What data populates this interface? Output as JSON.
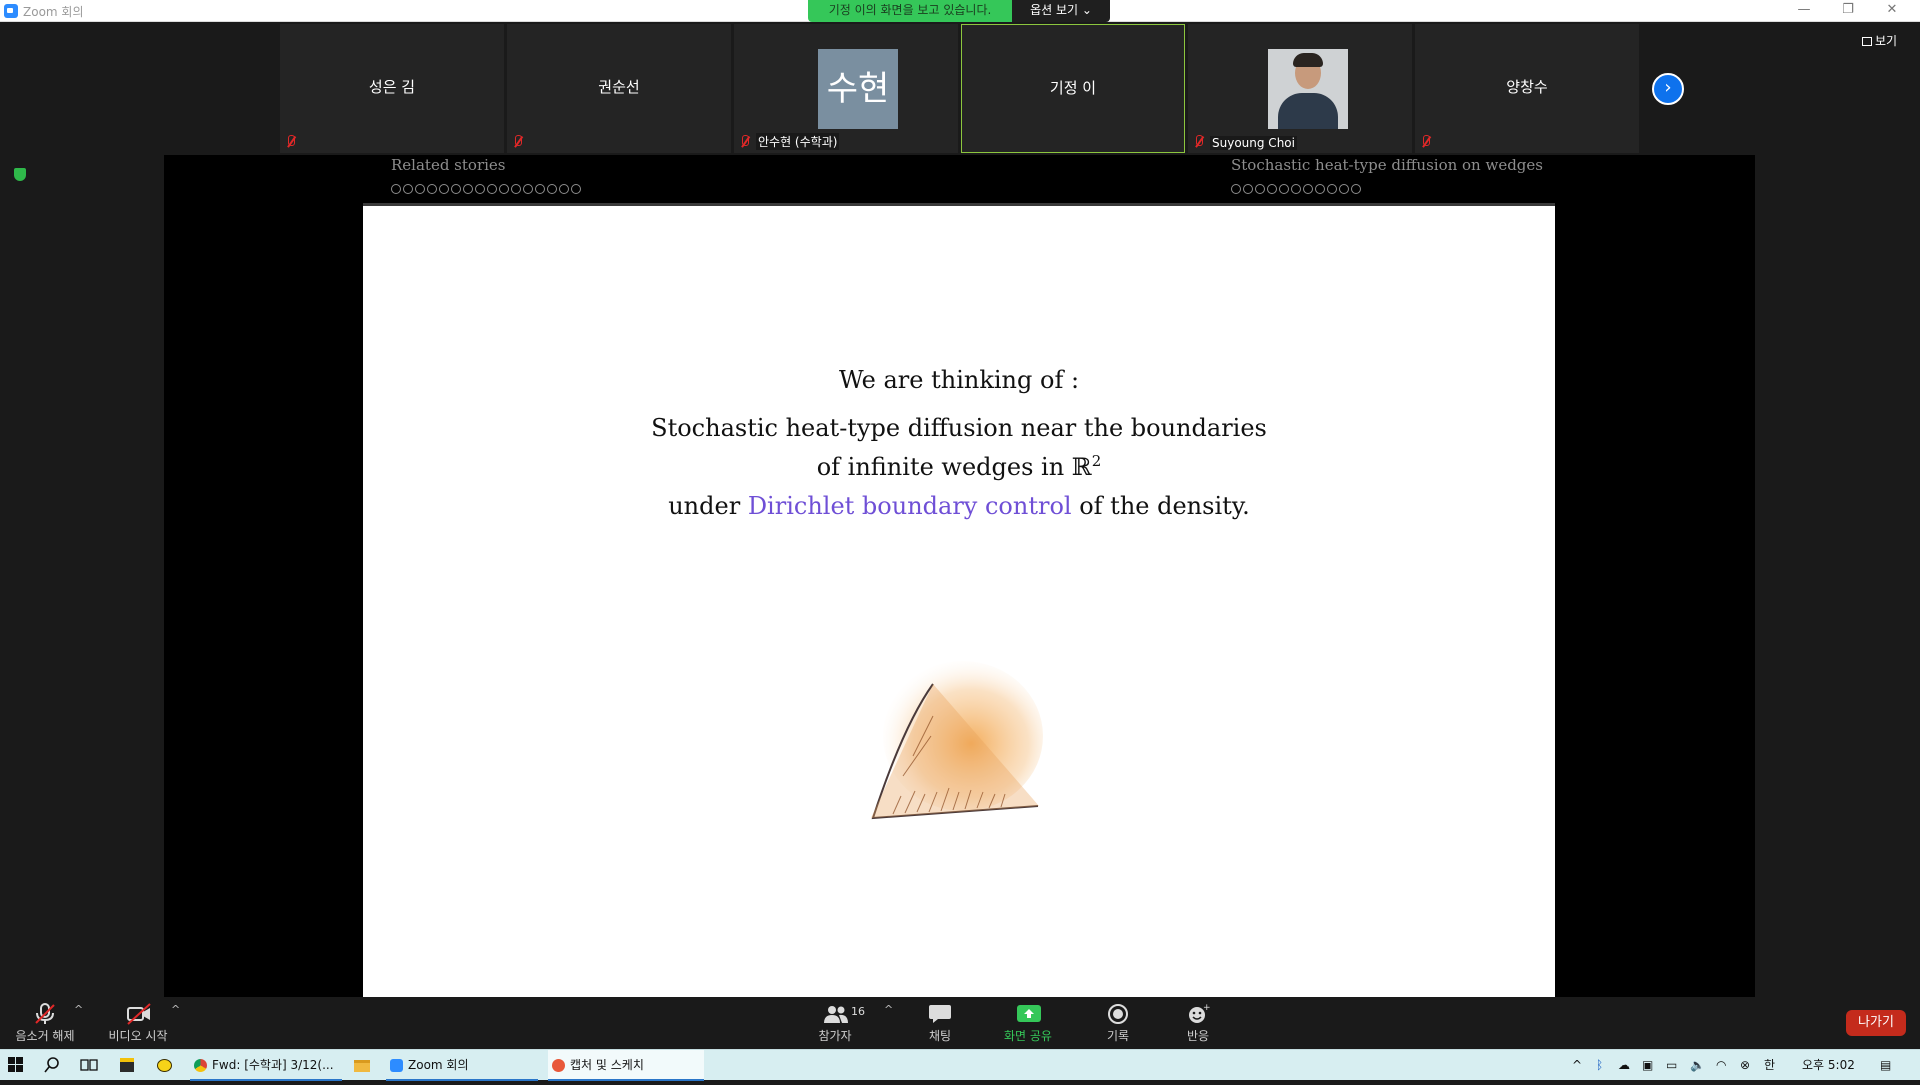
{
  "window": {
    "title": "Zoom 회의",
    "share_banner": "기정 이의 화면을 보고 있습니다.",
    "view_options": "옵션 보기"
  },
  "gallery": {
    "participants": [
      {
        "name": "성은 김",
        "label": ""
      },
      {
        "name": "권순선",
        "label": ""
      },
      {
        "name": "",
        "initials": "수현",
        "label": "안수현 (수학과)"
      },
      {
        "name": "기정 이",
        "label": ""
      },
      {
        "name": "",
        "label": "Suyoung Choi"
      },
      {
        "name": "양창수",
        "label": ""
      }
    ],
    "view_label": "보기"
  },
  "slide": {
    "header_left": "Related stories",
    "header_right": "Stochastic heat-type diffusion on wedges",
    "line1": "We are thinking of :",
    "line2": "Stochastic heat-type diffusion near the boundaries",
    "line3_prefix": "of infinite wedges in ",
    "line3_math": "ℝ",
    "line3_sup": "2",
    "line4_prefix": "under ",
    "line4_accent": "Dirichlet boundary control",
    "line4_suffix": " of the density.",
    "accent_color": "#6f4fd6"
  },
  "toolbar": {
    "mute": "음소거 해제",
    "video": "비디오 시작",
    "participants": "참가자",
    "participants_count": "16",
    "chat": "채팅",
    "share": "화면 공유",
    "record": "기록",
    "reactions": "반응",
    "leave": "나가기"
  },
  "taskbar": {
    "items": [
      "Fwd: [수학과] 3/12(...",
      "Zoom 회의",
      "캡처 및 스케치"
    ],
    "ime": "한",
    "clock": "오후 5:02"
  }
}
